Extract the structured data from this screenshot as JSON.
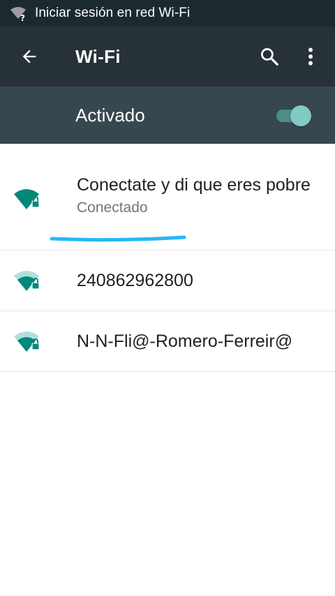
{
  "status_bar": {
    "notification_text": "Iniciar sesión en red Wi-Fi",
    "icon": "wifi-question-icon"
  },
  "app_bar": {
    "title": "Wi-Fi",
    "back_icon": "arrow-left-icon",
    "search_icon": "search-icon",
    "more_icon": "more-vert-icon"
  },
  "wifi_toggle": {
    "label": "Activado",
    "state": "on"
  },
  "networks": [
    {
      "name": "Conectate y di que eres pobre",
      "status": "Conectado",
      "secured": true,
      "signal": "full"
    },
    {
      "name": "240862962800",
      "secured": true,
      "signal": "medium"
    },
    {
      "name": "N-N-Fli@-Romero-Ferreir@",
      "secured": true,
      "signal": "medium"
    }
  ],
  "colors": {
    "status_bar": "#1c2a30",
    "app_bar": "#263238",
    "switch_bar": "#37474f",
    "accent": "#00897b",
    "annotation": "#29b6f6"
  }
}
